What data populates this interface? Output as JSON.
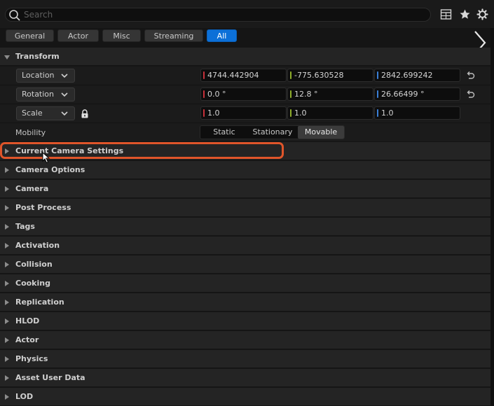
{
  "search": {
    "placeholder": "Search"
  },
  "toolbar": {
    "icons": [
      "table-view-icon",
      "star-icon",
      "settings-gear-icon"
    ]
  },
  "filters": [
    {
      "label": "General",
      "active": false
    },
    {
      "label": "Actor",
      "active": false
    },
    {
      "label": "Misc",
      "active": false
    },
    {
      "label": "Streaming",
      "active": false
    },
    {
      "label": "All",
      "active": true
    }
  ],
  "transform": {
    "header": "Transform",
    "location": {
      "label": "Location",
      "x": "4744.442904",
      "y": "-775.630528",
      "z": "2842.699242"
    },
    "rotation": {
      "label": "Rotation",
      "x": "0.0 °",
      "y": "12.8 °",
      "z": "26.66499 °"
    },
    "scale": {
      "label": "Scale",
      "x": "1.0",
      "y": "1.0",
      "z": "1.0"
    },
    "mobility": {
      "label": "Mobility",
      "options": [
        "Static",
        "Stationary",
        "Movable"
      ],
      "selected": "Movable"
    }
  },
  "sections": [
    "Current Camera Settings",
    "Camera Options",
    "Camera",
    "Post Process",
    "Tags",
    "Activation",
    "Collision",
    "Cooking",
    "Replication",
    "HLOD",
    "Actor",
    "Physics",
    "Asset User Data",
    "LOD"
  ],
  "colors": {
    "x_axis": "#c8313a",
    "y_axis": "#8fae2b",
    "z_axis": "#3a7fd6",
    "accent": "#0c70d8",
    "highlight": "#e0552a"
  }
}
